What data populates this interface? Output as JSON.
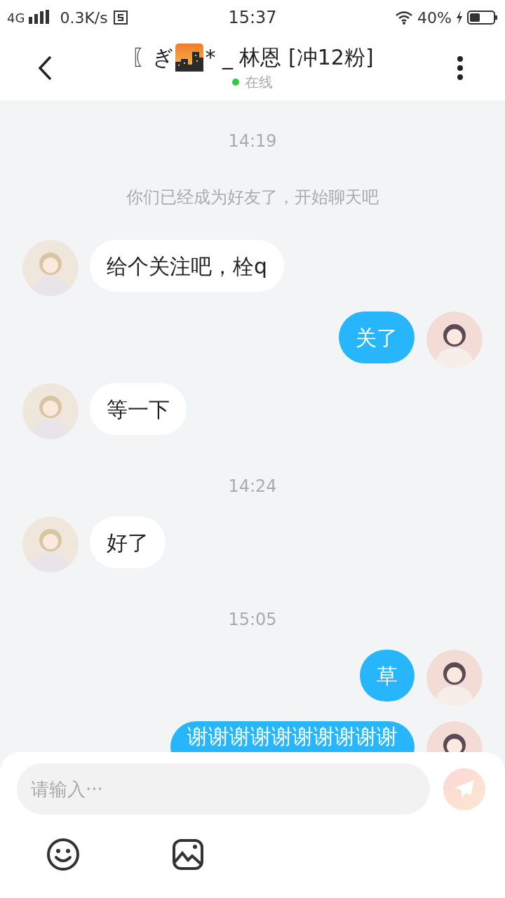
{
  "status_bar": {
    "network": "4G",
    "speed": "0.3K/s",
    "time": "15:37",
    "battery": "40%"
  },
  "header": {
    "title_before": "〖ぎ",
    "title_after": "* _ 林恩  [冲12粉]",
    "presence": "在线",
    "online": true
  },
  "messages": [
    {
      "kind": "time",
      "text": "14:19"
    },
    {
      "kind": "notice",
      "text": "你们已经成为好友了，开始聊天吧"
    },
    {
      "kind": "incoming",
      "text": "给个关注吧，栓q"
    },
    {
      "kind": "outgoing",
      "text": "关了"
    },
    {
      "kind": "incoming",
      "text": "等一下"
    },
    {
      "kind": "time",
      "text": "14:24"
    },
    {
      "kind": "incoming",
      "text": "好了"
    },
    {
      "kind": "time",
      "text": "15:05"
    },
    {
      "kind": "outgoing",
      "text": "草"
    },
    {
      "kind": "outgoing",
      "text": "谢谢谢谢谢谢谢谢谢谢"
    }
  ],
  "composer": {
    "placeholder": "请输入···"
  }
}
